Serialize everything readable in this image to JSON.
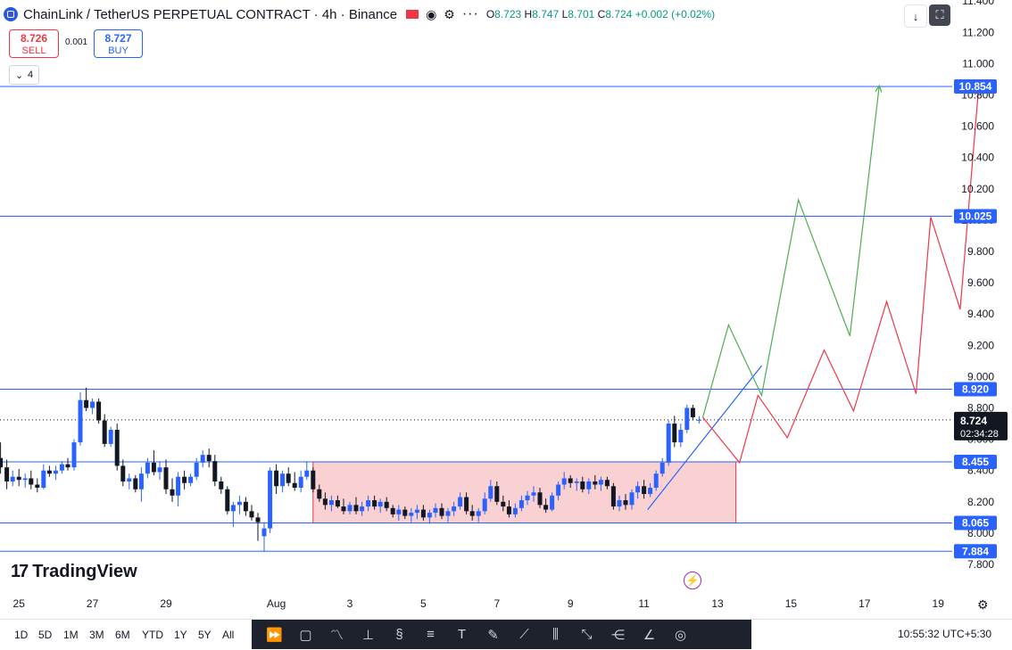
{
  "header": {
    "symbol_title": "ChainLink / TetherUS PERPETUAL CONTRACT · 4h · Binance",
    "ohlc_o_label": "O",
    "ohlc_o": "8.723",
    "ohlc_h_label": "H",
    "ohlc_h": "8.747",
    "ohlc_l_label": "L",
    "ohlc_l": "8.701",
    "ohlc_c_label": "C",
    "ohlc_c": "8.724",
    "change": "+0.002 (+0.02%)"
  },
  "trade": {
    "sell_price": "8.726",
    "sell_label": "SELL",
    "spread": "0.001",
    "buy_price": "8.727",
    "buy_label": "BUY"
  },
  "indicators": {
    "count": "4"
  },
  "branding": {
    "logo_text": "TradingView"
  },
  "timeframes": [
    "1D",
    "5D",
    "1M",
    "3M",
    "6M",
    "YTD",
    "1Y",
    "5Y",
    "All"
  ],
  "clock": "10:55:32 UTC+5:30",
  "icons": {
    "toolbar": [
      "replay-icon",
      "rectangle-icon",
      "pattern-icon",
      "long-position-icon",
      "short-position-icon",
      "fib-icon",
      "text-icon",
      "brush-icon",
      "trendline-icon",
      "bars-pattern-icon",
      "path-icon",
      "fork-icon",
      "projection-icon",
      "gann-icon"
    ]
  },
  "colors": {
    "bull": "#2962ff",
    "bear": "#131722",
    "hline": "#2962ff",
    "zone_fill": "#f7c5c8",
    "zone_border": "#f23645",
    "green_path": "#4caf50",
    "red_path": "#f23645",
    "label_bg": "#2962ff"
  },
  "chart_data": {
    "type": "candlestick",
    "title": "ChainLink / TetherUS PERPETUAL CONTRACT · 4h · Binance",
    "ylim": [
      7.8,
      11.4
    ],
    "y_ticks": [
      "11.400",
      "11.200",
      "11.000",
      "10.800",
      "10.600",
      "10.400",
      "10.200",
      "10.000",
      "9.800",
      "9.600",
      "9.400",
      "9.200",
      "9.000",
      "8.800",
      "8.600",
      "8.400",
      "8.200",
      "8.000",
      "7.800"
    ],
    "x_ticks": [
      {
        "label": "25",
        "day": -6
      },
      {
        "label": "27",
        "day": -4
      },
      {
        "label": "29",
        "day": -2
      },
      {
        "label": "Aug",
        "day": 1
      },
      {
        "label": "3",
        "day": 3
      },
      {
        "label": "5",
        "day": 5
      },
      {
        "label": "7",
        "day": 7
      },
      {
        "label": "9",
        "day": 9
      },
      {
        "label": "11",
        "day": 11
      },
      {
        "label": "13",
        "day": 13
      },
      {
        "label": "15",
        "day": 15
      },
      {
        "label": "17",
        "day": 17
      },
      {
        "label": "19",
        "day": 19
      }
    ],
    "horizontal_levels": [
      "10.854",
      "10.025",
      "8.920",
      "8.455",
      "8.065",
      "7.884"
    ],
    "last_price": {
      "value": "8.724",
      "countdown": "02:34:28"
    },
    "zone": {
      "day_start": 2.0,
      "day_end": 13.5,
      "low": 8.065,
      "high": 8.455
    },
    "candles": [
      {
        "d": -6.5,
        "o": 8.48,
        "h": 8.58,
        "l": 8.38,
        "c": 8.42
      },
      {
        "d": -6.33,
        "o": 8.42,
        "h": 8.47,
        "l": 8.28,
        "c": 8.33
      },
      {
        "d": -6.17,
        "o": 8.33,
        "h": 8.4,
        "l": 8.3,
        "c": 8.36
      },
      {
        "d": -6.0,
        "o": 8.36,
        "h": 8.41,
        "l": 8.3,
        "c": 8.34
      },
      {
        "d": -5.83,
        "o": 8.34,
        "h": 8.38,
        "l": 8.29,
        "c": 8.35
      },
      {
        "d": -5.67,
        "o": 8.35,
        "h": 8.4,
        "l": 8.28,
        "c": 8.31
      },
      {
        "d": -5.5,
        "o": 8.31,
        "h": 8.35,
        "l": 8.26,
        "c": 8.29
      },
      {
        "d": -5.33,
        "o": 8.29,
        "h": 8.44,
        "l": 8.28,
        "c": 8.4
      },
      {
        "d": -5.17,
        "o": 8.4,
        "h": 8.43,
        "l": 8.36,
        "c": 8.38
      },
      {
        "d": -5.0,
        "o": 8.38,
        "h": 8.43,
        "l": 8.34,
        "c": 8.4
      },
      {
        "d": -4.83,
        "o": 8.4,
        "h": 8.46,
        "l": 8.38,
        "c": 8.44
      },
      {
        "d": -4.67,
        "o": 8.44,
        "h": 8.48,
        "l": 8.4,
        "c": 8.42
      },
      {
        "d": -4.5,
        "o": 8.42,
        "h": 8.6,
        "l": 8.4,
        "c": 8.58
      },
      {
        "d": -4.33,
        "o": 8.58,
        "h": 8.9,
        "l": 8.56,
        "c": 8.85
      },
      {
        "d": -4.17,
        "o": 8.85,
        "h": 8.93,
        "l": 8.78,
        "c": 8.8
      },
      {
        "d": -4.0,
        "o": 8.8,
        "h": 8.86,
        "l": 8.76,
        "c": 8.84
      },
      {
        "d": -3.83,
        "o": 8.84,
        "h": 8.86,
        "l": 8.7,
        "c": 8.72
      },
      {
        "d": -3.67,
        "o": 8.72,
        "h": 8.76,
        "l": 8.55,
        "c": 8.57
      },
      {
        "d": -3.5,
        "o": 8.57,
        "h": 8.68,
        "l": 8.55,
        "c": 8.66
      },
      {
        "d": -3.33,
        "o": 8.66,
        "h": 8.7,
        "l": 8.4,
        "c": 8.43
      },
      {
        "d": -3.17,
        "o": 8.43,
        "h": 8.47,
        "l": 8.3,
        "c": 8.33
      },
      {
        "d": -3.0,
        "o": 8.33,
        "h": 8.38,
        "l": 8.28,
        "c": 8.35
      },
      {
        "d": -2.83,
        "o": 8.35,
        "h": 8.37,
        "l": 8.26,
        "c": 8.28
      },
      {
        "d": -2.67,
        "o": 8.28,
        "h": 8.42,
        "l": 8.2,
        "c": 8.38
      },
      {
        "d": -2.5,
        "o": 8.38,
        "h": 8.48,
        "l": 8.35,
        "c": 8.45
      },
      {
        "d": -2.33,
        "o": 8.45,
        "h": 8.53,
        "l": 8.37,
        "c": 8.39
      },
      {
        "d": -2.17,
        "o": 8.39,
        "h": 8.46,
        "l": 8.34,
        "c": 8.42
      },
      {
        "d": -2.0,
        "o": 8.42,
        "h": 8.47,
        "l": 8.25,
        "c": 8.28
      },
      {
        "d": -1.83,
        "o": 8.28,
        "h": 8.35,
        "l": 8.2,
        "c": 8.24
      },
      {
        "d": -1.67,
        "o": 8.24,
        "h": 8.39,
        "l": 8.17,
        "c": 8.36
      },
      {
        "d": -1.5,
        "o": 8.36,
        "h": 8.4,
        "l": 8.28,
        "c": 8.32
      },
      {
        "d": -1.33,
        "o": 8.32,
        "h": 8.38,
        "l": 8.3,
        "c": 8.36
      },
      {
        "d": -1.17,
        "o": 8.36,
        "h": 8.48,
        "l": 8.34,
        "c": 8.45
      },
      {
        "d": -1.0,
        "o": 8.45,
        "h": 8.53,
        "l": 8.42,
        "c": 8.5
      },
      {
        "d": -0.83,
        "o": 8.5,
        "h": 8.54,
        "l": 8.42,
        "c": 8.46
      },
      {
        "d": -0.67,
        "o": 8.46,
        "h": 8.5,
        "l": 8.3,
        "c": 8.33
      },
      {
        "d": -0.5,
        "o": 8.33,
        "h": 8.36,
        "l": 8.25,
        "c": 8.28
      },
      {
        "d": -0.33,
        "o": 8.28,
        "h": 8.3,
        "l": 8.12,
        "c": 8.14
      },
      {
        "d": -0.17,
        "o": 8.14,
        "h": 8.2,
        "l": 8.04,
        "c": 8.18
      },
      {
        "d": 0.0,
        "o": 8.18,
        "h": 8.24,
        "l": 8.12,
        "c": 8.2
      },
      {
        "d": 0.17,
        "o": 8.2,
        "h": 8.23,
        "l": 8.11,
        "c": 8.14
      },
      {
        "d": 0.33,
        "o": 8.14,
        "h": 8.18,
        "l": 8.08,
        "c": 8.1
      },
      {
        "d": 0.5,
        "o": 8.1,
        "h": 8.13,
        "l": 7.95,
        "c": 8.07
      },
      {
        "d": 0.67,
        "o": 7.98,
        "h": 8.07,
        "l": 7.88,
        "c": 8.03
      },
      {
        "d": 0.83,
        "o": 8.03,
        "h": 8.42,
        "l": 8.0,
        "c": 8.4
      },
      {
        "d": 1.0,
        "o": 8.4,
        "h": 8.44,
        "l": 8.25,
        "c": 8.3
      },
      {
        "d": 1.17,
        "o": 8.3,
        "h": 8.4,
        "l": 8.26,
        "c": 8.38
      },
      {
        "d": 1.33,
        "o": 8.38,
        "h": 8.42,
        "l": 8.3,
        "c": 8.32
      },
      {
        "d": 1.5,
        "o": 8.32,
        "h": 8.39,
        "l": 8.27,
        "c": 8.29
      },
      {
        "d": 1.67,
        "o": 8.29,
        "h": 8.4,
        "l": 8.26,
        "c": 8.36
      },
      {
        "d": 1.83,
        "o": 8.36,
        "h": 8.46,
        "l": 8.34,
        "c": 8.4
      },
      {
        "d": 2.0,
        "o": 8.4,
        "h": 8.42,
        "l": 8.26,
        "c": 8.28
      },
      {
        "d": 2.17,
        "o": 8.28,
        "h": 8.31,
        "l": 8.2,
        "c": 8.22
      },
      {
        "d": 2.33,
        "o": 8.22,
        "h": 8.26,
        "l": 8.15,
        "c": 8.18
      },
      {
        "d": 2.5,
        "o": 8.18,
        "h": 8.24,
        "l": 8.14,
        "c": 8.21
      },
      {
        "d": 2.67,
        "o": 8.21,
        "h": 8.24,
        "l": 8.16,
        "c": 8.17
      },
      {
        "d": 2.83,
        "o": 8.17,
        "h": 8.22,
        "l": 8.12,
        "c": 8.14
      },
      {
        "d": 3.0,
        "o": 8.14,
        "h": 8.2,
        "l": 8.12,
        "c": 8.18
      },
      {
        "d": 3.17,
        "o": 8.18,
        "h": 8.23,
        "l": 8.12,
        "c": 8.14
      },
      {
        "d": 3.33,
        "o": 8.14,
        "h": 8.2,
        "l": 8.11,
        "c": 8.17
      },
      {
        "d": 3.5,
        "o": 8.17,
        "h": 8.24,
        "l": 8.14,
        "c": 8.21
      },
      {
        "d": 3.67,
        "o": 8.21,
        "h": 8.24,
        "l": 8.15,
        "c": 8.17
      },
      {
        "d": 3.83,
        "o": 8.17,
        "h": 8.22,
        "l": 8.13,
        "c": 8.2
      },
      {
        "d": 4.0,
        "o": 8.2,
        "h": 8.23,
        "l": 8.14,
        "c": 8.16
      },
      {
        "d": 4.17,
        "o": 8.16,
        "h": 8.18,
        "l": 8.1,
        "c": 8.12
      },
      {
        "d": 4.33,
        "o": 8.12,
        "h": 8.18,
        "l": 8.08,
        "c": 8.15
      },
      {
        "d": 4.5,
        "o": 8.15,
        "h": 8.17,
        "l": 8.09,
        "c": 8.11
      },
      {
        "d": 4.67,
        "o": 8.11,
        "h": 8.16,
        "l": 8.07,
        "c": 8.13
      },
      {
        "d": 4.83,
        "o": 8.13,
        "h": 8.18,
        "l": 8.09,
        "c": 8.15
      },
      {
        "d": 5.0,
        "o": 8.15,
        "h": 8.18,
        "l": 8.08,
        "c": 8.1
      },
      {
        "d": 5.17,
        "o": 8.1,
        "h": 8.15,
        "l": 8.06,
        "c": 8.13
      },
      {
        "d": 5.33,
        "o": 8.13,
        "h": 8.19,
        "l": 8.1,
        "c": 8.16
      },
      {
        "d": 5.5,
        "o": 8.16,
        "h": 8.19,
        "l": 8.09,
        "c": 8.11
      },
      {
        "d": 5.67,
        "o": 8.11,
        "h": 8.16,
        "l": 8.07,
        "c": 8.14
      },
      {
        "d": 5.83,
        "o": 8.14,
        "h": 8.2,
        "l": 8.11,
        "c": 8.17
      },
      {
        "d": 6.0,
        "o": 8.17,
        "h": 8.26,
        "l": 8.15,
        "c": 8.23
      },
      {
        "d": 6.17,
        "o": 8.23,
        "h": 8.26,
        "l": 8.12,
        "c": 8.14
      },
      {
        "d": 6.33,
        "o": 8.14,
        "h": 8.18,
        "l": 8.08,
        "c": 8.11
      },
      {
        "d": 6.5,
        "o": 8.11,
        "h": 8.16,
        "l": 8.07,
        "c": 8.14
      },
      {
        "d": 6.67,
        "o": 8.14,
        "h": 8.26,
        "l": 8.12,
        "c": 8.22
      },
      {
        "d": 6.83,
        "o": 8.22,
        "h": 8.34,
        "l": 8.2,
        "c": 8.3
      },
      {
        "d": 7.0,
        "o": 8.3,
        "h": 8.33,
        "l": 8.18,
        "c": 8.2
      },
      {
        "d": 7.17,
        "o": 8.2,
        "h": 8.24,
        "l": 8.14,
        "c": 8.17
      },
      {
        "d": 7.33,
        "o": 8.17,
        "h": 8.21,
        "l": 8.1,
        "c": 8.12
      },
      {
        "d": 7.5,
        "o": 8.12,
        "h": 8.19,
        "l": 8.1,
        "c": 8.16
      },
      {
        "d": 7.67,
        "o": 8.16,
        "h": 8.24,
        "l": 8.14,
        "c": 8.21
      },
      {
        "d": 7.83,
        "o": 8.21,
        "h": 8.27,
        "l": 8.18,
        "c": 8.24
      },
      {
        "d": 8.0,
        "o": 8.24,
        "h": 8.3,
        "l": 8.2,
        "c": 8.26
      },
      {
        "d": 8.17,
        "o": 8.26,
        "h": 8.29,
        "l": 8.16,
        "c": 8.18
      },
      {
        "d": 8.33,
        "o": 8.18,
        "h": 8.22,
        "l": 8.13,
        "c": 8.15
      },
      {
        "d": 8.5,
        "o": 8.15,
        "h": 8.26,
        "l": 8.14,
        "c": 8.24
      },
      {
        "d": 8.67,
        "o": 8.24,
        "h": 8.33,
        "l": 8.21,
        "c": 8.31
      },
      {
        "d": 8.83,
        "o": 8.31,
        "h": 8.39,
        "l": 8.28,
        "c": 8.35
      },
      {
        "d": 9.0,
        "o": 8.35,
        "h": 8.37,
        "l": 8.29,
        "c": 8.32
      },
      {
        "d": 9.17,
        "o": 8.32,
        "h": 8.35,
        "l": 8.27,
        "c": 8.33
      },
      {
        "d": 9.33,
        "o": 8.33,
        "h": 8.36,
        "l": 8.26,
        "c": 8.28
      },
      {
        "d": 9.5,
        "o": 8.28,
        "h": 8.35,
        "l": 8.25,
        "c": 8.33
      },
      {
        "d": 9.67,
        "o": 8.33,
        "h": 8.37,
        "l": 8.28,
        "c": 8.31
      },
      {
        "d": 9.83,
        "o": 8.31,
        "h": 8.36,
        "l": 8.27,
        "c": 8.34
      },
      {
        "d": 10.0,
        "o": 8.34,
        "h": 8.36,
        "l": 8.28,
        "c": 8.3
      },
      {
        "d": 10.17,
        "o": 8.3,
        "h": 8.32,
        "l": 8.15,
        "c": 8.17
      },
      {
        "d": 10.33,
        "o": 8.17,
        "h": 8.24,
        "l": 8.14,
        "c": 8.21
      },
      {
        "d": 10.5,
        "o": 8.21,
        "h": 8.25,
        "l": 8.15,
        "c": 8.18
      },
      {
        "d": 10.67,
        "o": 8.18,
        "h": 8.28,
        "l": 8.15,
        "c": 8.26
      },
      {
        "d": 10.83,
        "o": 8.26,
        "h": 8.33,
        "l": 8.22,
        "c": 8.3
      },
      {
        "d": 11.0,
        "o": 8.3,
        "h": 8.34,
        "l": 8.22,
        "c": 8.25
      },
      {
        "d": 11.17,
        "o": 8.25,
        "h": 8.32,
        "l": 8.23,
        "c": 8.29
      },
      {
        "d": 11.33,
        "o": 8.29,
        "h": 8.4,
        "l": 8.27,
        "c": 8.38
      },
      {
        "d": 11.5,
        "o": 8.38,
        "h": 8.48,
        "l": 8.36,
        "c": 8.45
      },
      {
        "d": 11.67,
        "o": 8.45,
        "h": 8.72,
        "l": 8.43,
        "c": 8.7
      },
      {
        "d": 11.83,
        "o": 8.7,
        "h": 8.75,
        "l": 8.55,
        "c": 8.58
      },
      {
        "d": 12.0,
        "o": 8.58,
        "h": 8.7,
        "l": 8.55,
        "c": 8.66
      },
      {
        "d": 12.17,
        "o": 8.66,
        "h": 8.82,
        "l": 8.64,
        "c": 8.8
      },
      {
        "d": 12.33,
        "o": 8.8,
        "h": 8.82,
        "l": 8.72,
        "c": 8.74
      },
      {
        "d": 12.5,
        "o": 8.723,
        "h": 8.747,
        "l": 8.701,
        "c": 8.724
      }
    ],
    "trendline": [
      {
        "d": 11.1,
        "v": 8.15
      },
      {
        "d": 14.2,
        "v": 9.07
      }
    ],
    "projections": [
      {
        "name": "green",
        "points": [
          {
            "d": 12.6,
            "v": 8.74
          },
          {
            "d": 13.3,
            "v": 9.33
          },
          {
            "d": 14.2,
            "v": 8.88
          },
          {
            "d": 15.2,
            "v": 10.13
          },
          {
            "d": 16.6,
            "v": 9.26
          },
          {
            "d": 17.4,
            "v": 10.86
          }
        ]
      },
      {
        "name": "red",
        "points": [
          {
            "d": 12.6,
            "v": 8.74
          },
          {
            "d": 13.6,
            "v": 8.45
          },
          {
            "d": 14.1,
            "v": 8.88
          },
          {
            "d": 14.9,
            "v": 8.61
          },
          {
            "d": 15.9,
            "v": 9.17
          },
          {
            "d": 16.7,
            "v": 8.78
          },
          {
            "d": 17.6,
            "v": 9.48
          },
          {
            "d": 18.4,
            "v": 8.89
          },
          {
            "d": 18.8,
            "v": 10.02
          },
          {
            "d": 19.6,
            "v": 9.43
          },
          {
            "d": 20.1,
            "v": 10.84
          }
        ]
      }
    ]
  }
}
